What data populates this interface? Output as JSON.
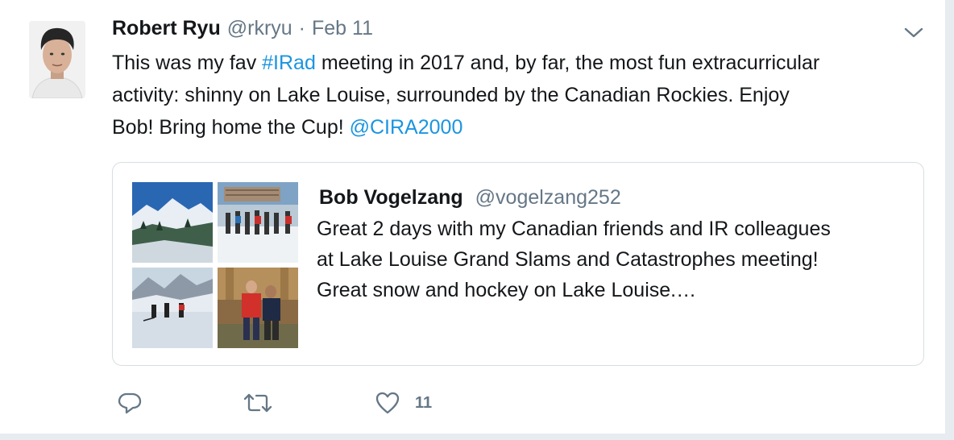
{
  "tweet": {
    "author_name": "Robert Ryu",
    "handle": "@rkryu",
    "separator": "·",
    "date": "Feb 11",
    "lines": [
      [
        {
          "t": "This was my fav "
        },
        {
          "t": "#IRad",
          "link": true
        },
        {
          "t": " meeting in 2017 and, by far, the most fun extracurricular"
        }
      ],
      [
        {
          "t": "activity: shinny on Lake Louise, surrounded by the Canadian Rockies. Enjoy"
        }
      ],
      [
        {
          "t": "Bob! Bring home the Cup! "
        },
        {
          "t": "@CIRA2000",
          "link": true
        }
      ]
    ]
  },
  "quoted": {
    "author_name": "Bob Vogelzang",
    "handle": "@vogelzang252",
    "lines": [
      "Great 2 days with my Canadian friends and IR colleagues",
      "at Lake Louise Grand Slams and Catastrophes meeting!",
      "Great snow and hockey on Lake Louise.…"
    ]
  },
  "actions": {
    "reply_icon": "reply-icon",
    "retweet_icon": "retweet-icon",
    "like_icon": "heart-icon",
    "like_count": "11"
  },
  "colors": {
    "link": "#1b95e0",
    "muted": "#657786",
    "border": "#d8dee2"
  }
}
